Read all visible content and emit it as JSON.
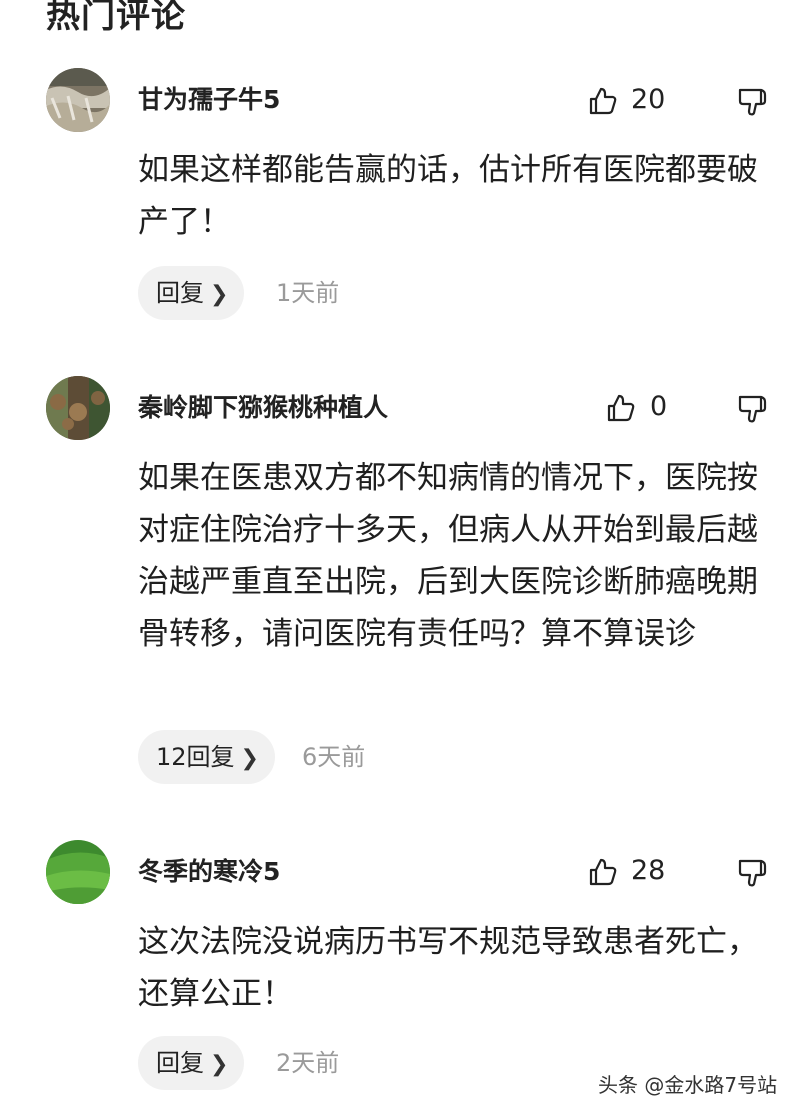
{
  "section_title": "热门评论",
  "comments": [
    {
      "username": "甘为孺子牛5",
      "likes": "20",
      "text": "如果这样都能告赢的话，估计所有医院都要破产了！",
      "reply_label": "回复",
      "time": "1天前",
      "avatar_icon": "avatar-waterfall-photo"
    },
    {
      "username": "秦岭脚下猕猴桃种植人",
      "likes": "0",
      "text": "如果在医患双方都不知病情的情况下，医院按对症住院治疗十多天，但病人从开始到最后越治越严重直至出院，后到大医院诊断肺癌晚期骨转移，请问医院有责任吗？算不算误诊",
      "reply_label": "12回复",
      "time": "6天前",
      "avatar_icon": "avatar-kiwi-fruit-photo"
    },
    {
      "username": "冬季的寒冷5",
      "likes": "28",
      "text": "这次法院没说病历书写不规范导致患者死亡，还算公正！",
      "reply_label": "回复",
      "time": "2天前",
      "avatar_icon": "avatar-grass-photo"
    }
  ],
  "watermark": "头条 @金水路7号站",
  "icons": {
    "like": "thumb-up-icon",
    "dislike": "thumb-down-icon",
    "reply_chevron": "chevron-right-icon"
  }
}
